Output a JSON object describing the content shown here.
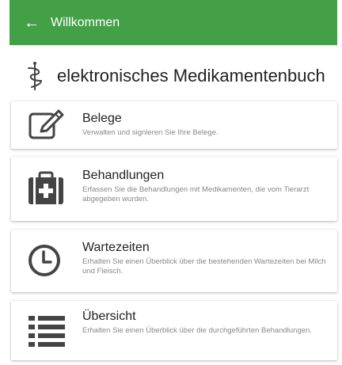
{
  "header": {
    "back_icon": "arrow-left-icon",
    "title": "Willkommen",
    "background_color": "#43a047"
  },
  "app": {
    "logo_icon": "caduceus-icon",
    "title": "elektronisches Medikamentenbuch"
  },
  "menu": [
    {
      "icon": "edit-document-icon",
      "title": "Belege",
      "description": "Verwalten und signieren Sie Ihre Belege."
    },
    {
      "icon": "first-aid-kit-icon",
      "title": "Behandlungen",
      "description": "Erfassen Sie die Behandlungen mit Medikamenten, die vom Tierarzt abgegeben wurden."
    },
    {
      "icon": "clock-icon",
      "title": "Wartezeiten",
      "description": "Erhalten Sie einen Überblick über die bestehenden Wartezeiten bei Milch und Fleisch."
    },
    {
      "icon": "list-icon",
      "title": "Übersicht",
      "description": "Erhalten Sie einen Überblick über die durchgeführten Behandlungen."
    }
  ]
}
